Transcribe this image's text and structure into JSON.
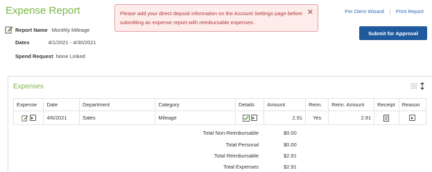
{
  "header": {
    "title": "Expense Report",
    "alert_text": "Please add your direct deposit information on the Account Settings page before submitting an expense report with reimbursable expenses.",
    "links": {
      "per_diem": "Per Diem Wizard",
      "print": "Print Report"
    },
    "submit_label": "Submit for Approval"
  },
  "report": {
    "name_label": "Report Name",
    "name_value": "Monthly Mileage",
    "dates_label": "Dates",
    "dates_value": "4/1/2021 - 4/30/2021",
    "spend_label": "Spend Request",
    "spend_value": "None Linked"
  },
  "expenses": {
    "title": "Expenses",
    "columns": [
      "Expense",
      "Date",
      "Department",
      "Category",
      "Details",
      "Amount",
      "Reim.",
      "Reim. Amount",
      "Receipt",
      "Reason"
    ],
    "rows": [
      {
        "date": "4/6/2021",
        "department": "Sales",
        "category": "Mileage",
        "amount": "2.91",
        "reim": "Yes",
        "reim_amount": "2.91"
      }
    ],
    "totals": [
      {
        "label": "Total Non-Reimbursable",
        "value": "$0.00"
      },
      {
        "label": "Total Personal",
        "value": "$0.00"
      },
      {
        "label": "Total Reimbursable",
        "value": "$2.91"
      },
      {
        "label": "Total Expenses",
        "value": "$2.91"
      }
    ]
  },
  "colors": {
    "accent_green": "#7ab648",
    "primary_blue": "#1f5a9e",
    "link_blue": "#2f6bb3",
    "alert_text": "#b03a3a"
  }
}
